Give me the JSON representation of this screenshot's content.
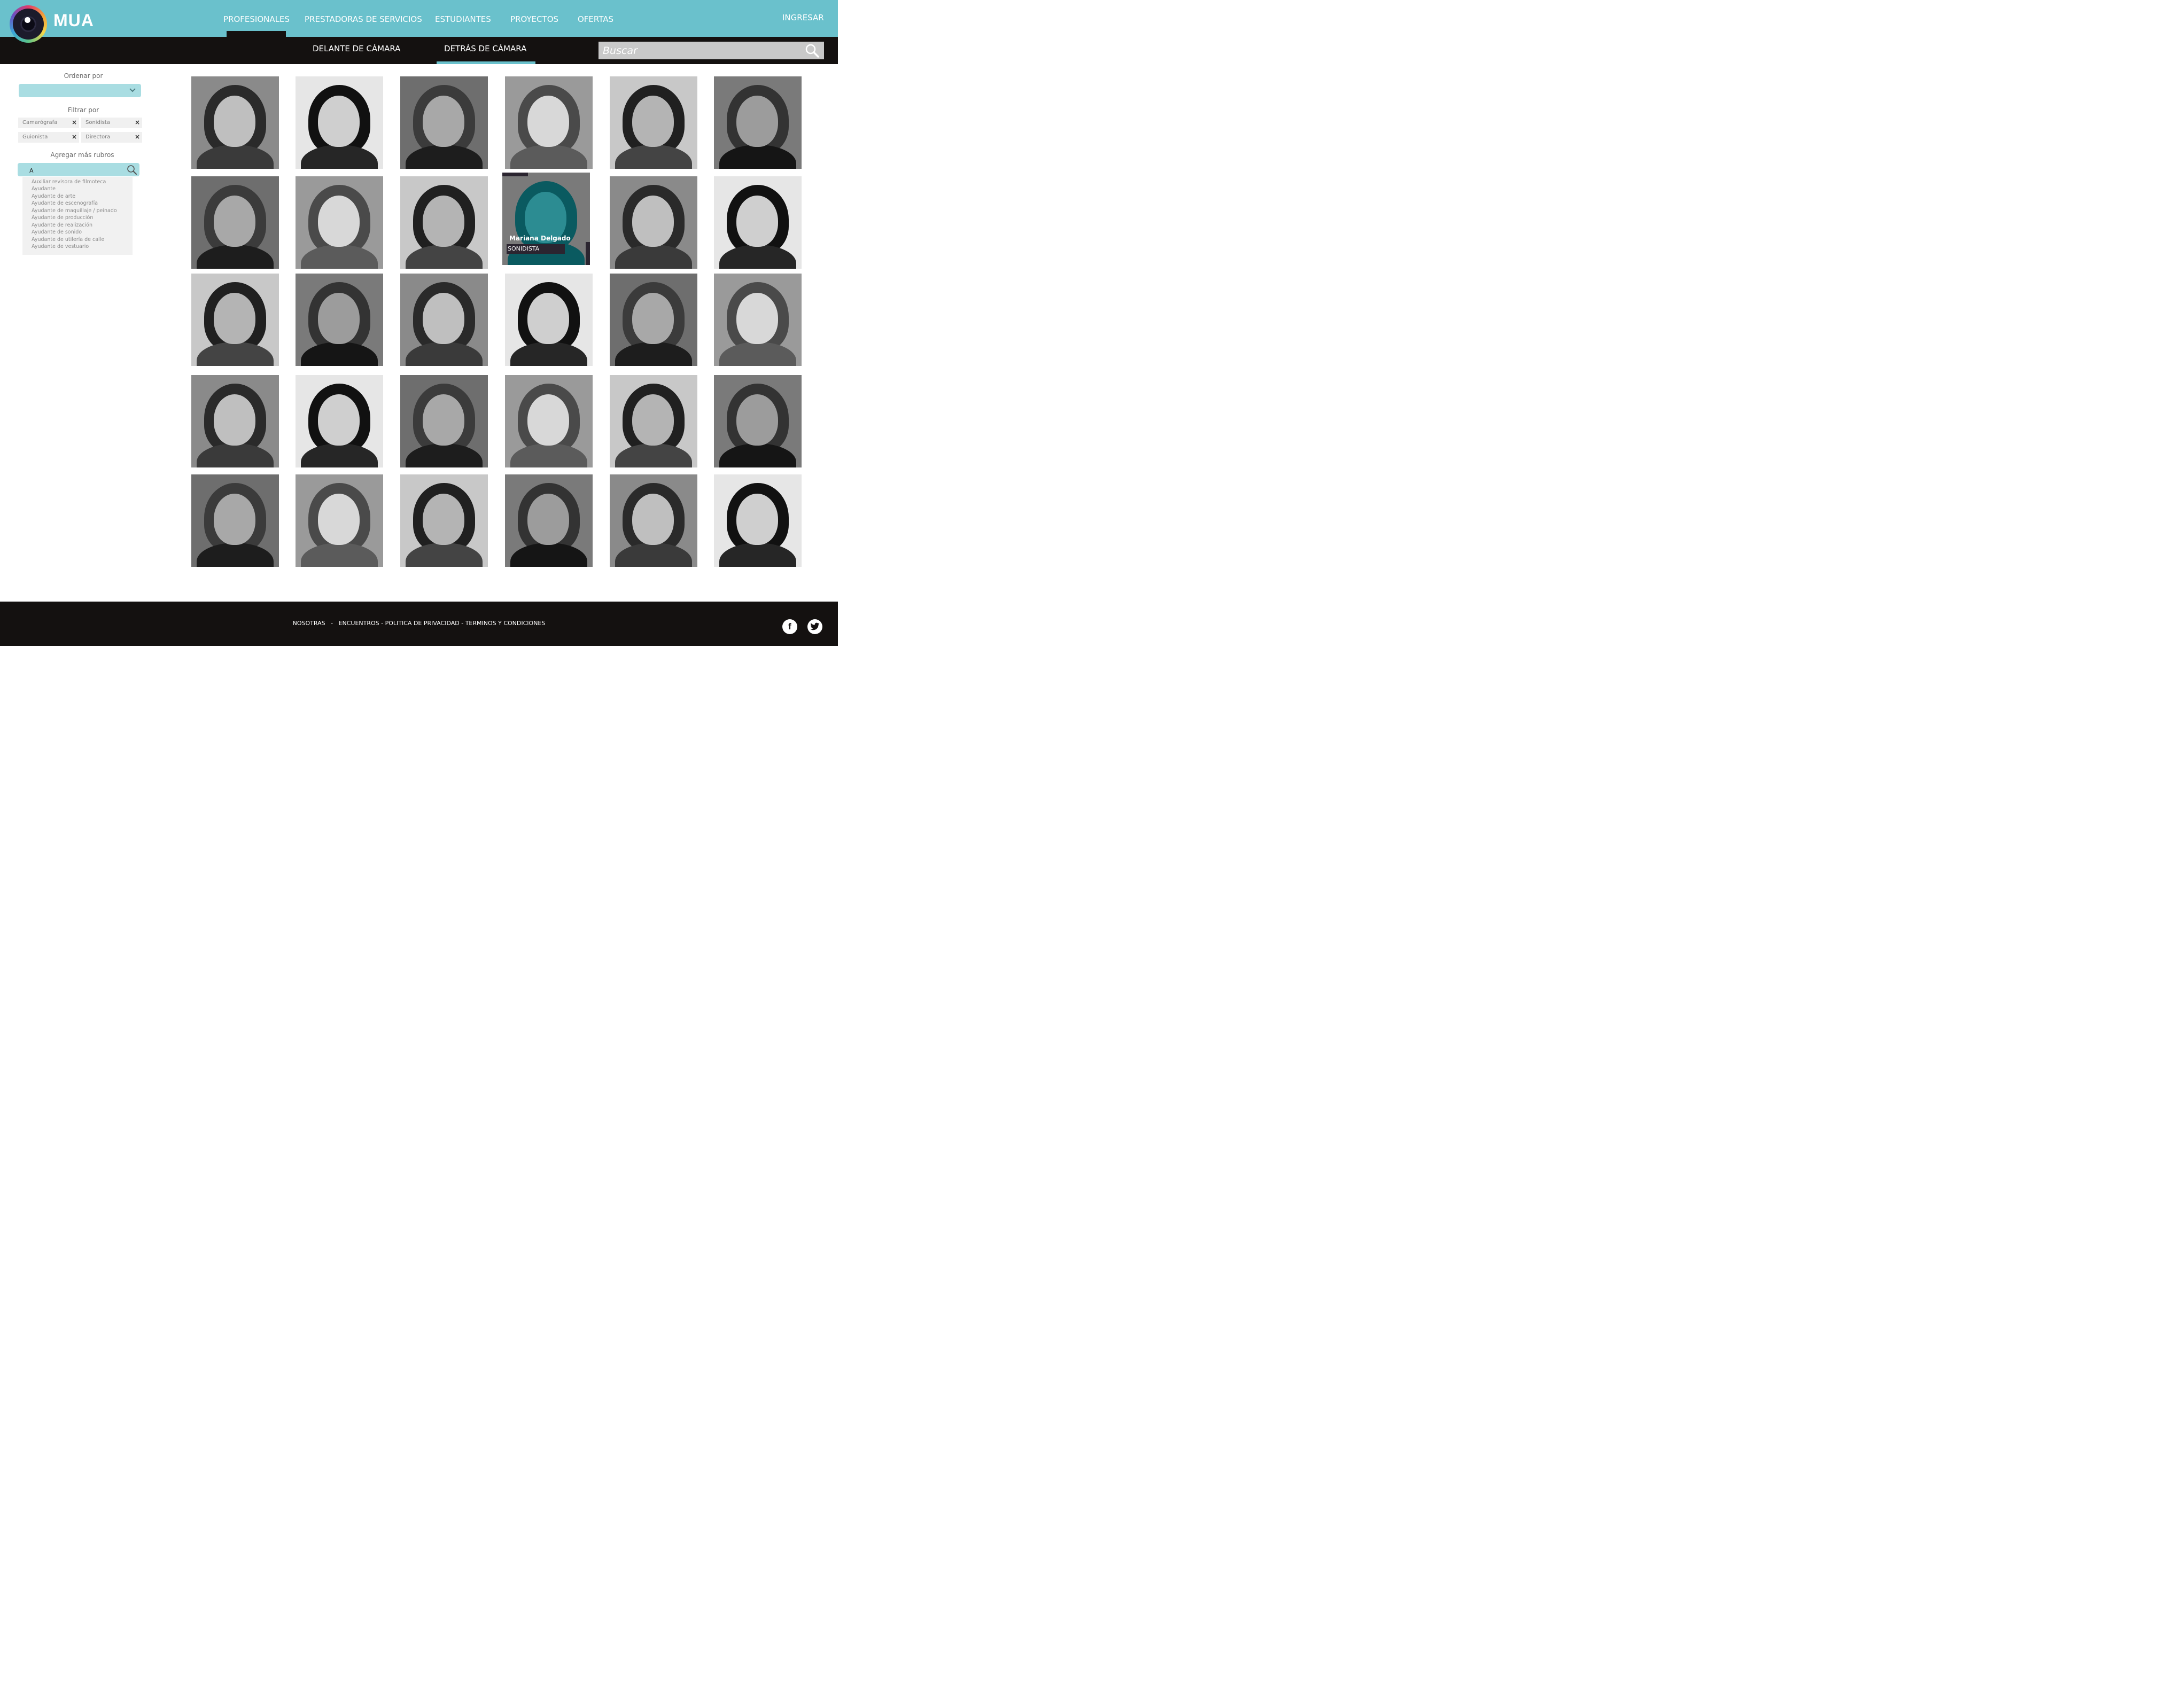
{
  "brand": {
    "name": "MUA"
  },
  "nav": {
    "items": [
      "PROFESIONALES",
      "PRESTADORAS DE SERVICIOS",
      "ESTUDIANTES",
      "PROYECTOS",
      "OFERTAS"
    ],
    "active": "PROFESIONALES",
    "login": "INGRESAR"
  },
  "subnav": {
    "tabs": [
      "DELANTE DE CÁMARA",
      "DETRÁS DE CÁMARA"
    ],
    "active": "DETRÁS DE CÁMARA"
  },
  "search": {
    "placeholder": "Buscar"
  },
  "sidebar": {
    "sort_label": "Ordenar por",
    "filter_label": "Filtrar por",
    "filters": [
      "Camarógrafa",
      "Sonidista",
      "Guionista",
      "Directora"
    ],
    "add_label": "Agregar más rubros",
    "add_value": "A",
    "suggestions": [
      "Auxiliar revisora de filmoteca",
      "Ayudante",
      "Ayudante de arte",
      "Ayudante de escenografía",
      "Ayudante de maquillaje / peinado",
      "Ayudante de producción",
      "Ayudante de realización",
      "Ayudante de sonido",
      "Ayudante de utilería de calle",
      "Ayudante de vestuario"
    ]
  },
  "grid": {
    "columns": 6,
    "rows": 5,
    "hovered": {
      "name": "Mariana Delgado",
      "role": "SONIDISTA"
    }
  },
  "footer": {
    "links": [
      "NOSOTRAS",
      "ENCUENTROS",
      "POLITICA DE PRIVACIDAD",
      "TERMINOS Y CONDICIONES"
    ],
    "social": [
      "facebook-icon",
      "twitter-icon"
    ]
  }
}
